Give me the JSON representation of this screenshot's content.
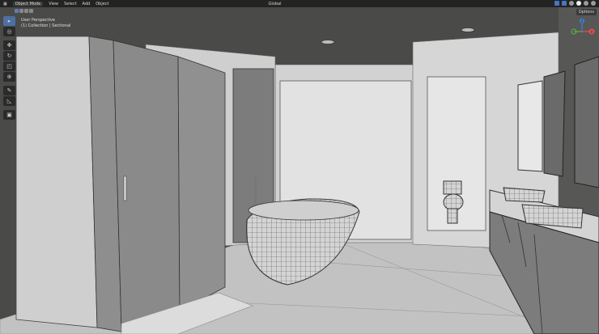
{
  "header": {
    "menu_icon": "editor-type-icon",
    "mode": "Object Mode",
    "menus": [
      "View",
      "Select",
      "Add",
      "Object"
    ],
    "orientation": "Global"
  },
  "viewport": {
    "view_name": "User Perspective",
    "collection": "(1) Collection | Sectional",
    "options_label": "Options"
  },
  "gizmo": {
    "axes": [
      "X",
      "Y",
      "Z"
    ]
  },
  "toolbar": {
    "tools": [
      "select-box-icon",
      "cursor-icon",
      "move-icon",
      "rotate-icon",
      "scale-icon",
      "transform-icon",
      "annotate-icon",
      "measure-icon",
      "add-cube-icon"
    ]
  },
  "colors": {
    "header": "#232323",
    "active_tool": "#4d6fa3",
    "ceiling": "#4a4a48",
    "wall": "#d6d6d6",
    "floor": "#c4c4c4"
  }
}
